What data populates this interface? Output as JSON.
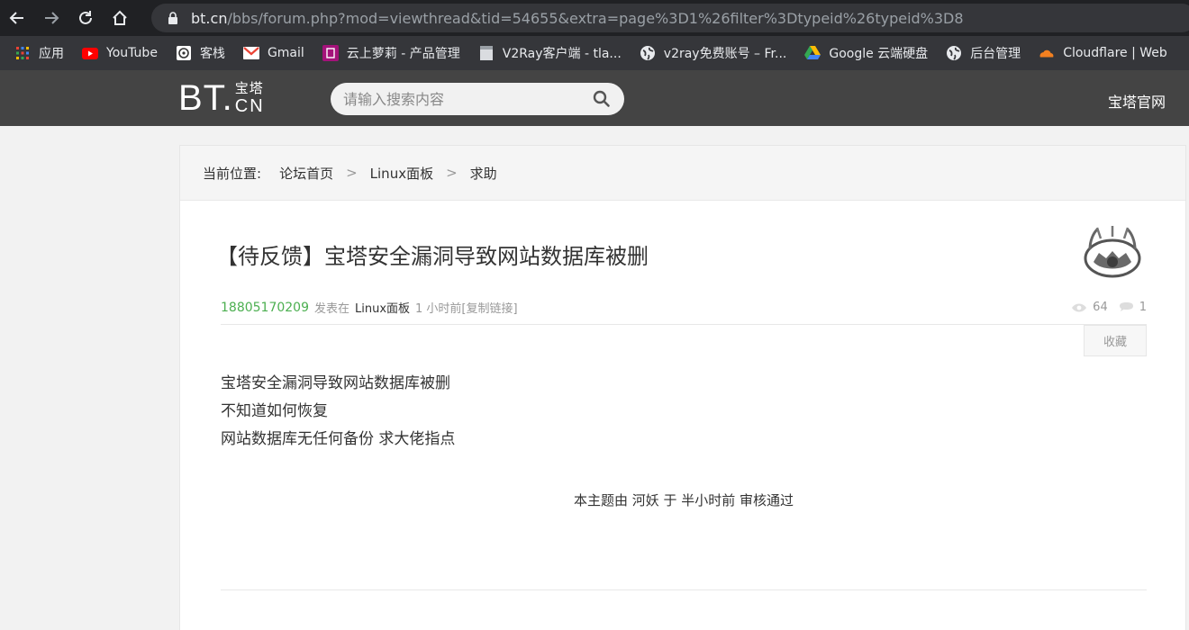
{
  "browser": {
    "url_host": "bt.cn",
    "url_path": "/bbs/forum.php?mod=viewthread&tid=54655&extra=page%3D1%26filter%3Dtypeid%26typeid%3D8",
    "bookmarks": [
      {
        "label": "应用",
        "icon": "apps-grid-icon"
      },
      {
        "label": "YouTube",
        "icon": "youtube-icon"
      },
      {
        "label": "客栈",
        "icon": "inn-icon"
      },
      {
        "label": "Gmail",
        "icon": "gmail-icon"
      },
      {
        "label": "云上萝莉 - 产品管理",
        "icon": "product-icon"
      },
      {
        "label": "V2Ray客户端 - tla...",
        "icon": "page-icon"
      },
      {
        "label": "v2ray免费账号 – Fr...",
        "icon": "globe-icon"
      },
      {
        "label": "Google 云端硬盘",
        "icon": "google-drive-icon"
      },
      {
        "label": "后台管理",
        "icon": "globe-icon"
      },
      {
        "label": "Cloudflare | Web",
        "icon": "cloudflare-icon"
      }
    ]
  },
  "header": {
    "logo_bt": "BT.",
    "logo_cn_top": "宝塔",
    "logo_cn_bottom": "CN",
    "search_placeholder": "请输入搜索内容",
    "official_link": "宝塔官网"
  },
  "breadcrumb": {
    "prefix": "当前位置:",
    "items": [
      "论坛首页",
      "Linux面板",
      "求助"
    ],
    "separator": ">"
  },
  "post": {
    "title": "【待反馈】宝塔安全漏洞导致网站数据库被删",
    "author": "18805170209",
    "posted_in_label": "发表在",
    "forum": "Linux面板",
    "time": "1 小时前[复制链接]",
    "views": "64",
    "replies": "1",
    "favorite_label": "收藏",
    "body_lines": [
      "宝塔安全漏洞导致网站数据库被删",
      "不知道如何恢复",
      "网站数据库无任何备份 求大佬指点"
    ],
    "audit_note": "本主题由 河妖 于 半小时前 审核通过"
  },
  "colors": {
    "header_bg": "#444444",
    "author_green": "#4caf50",
    "chrome_dark": "#202124"
  }
}
